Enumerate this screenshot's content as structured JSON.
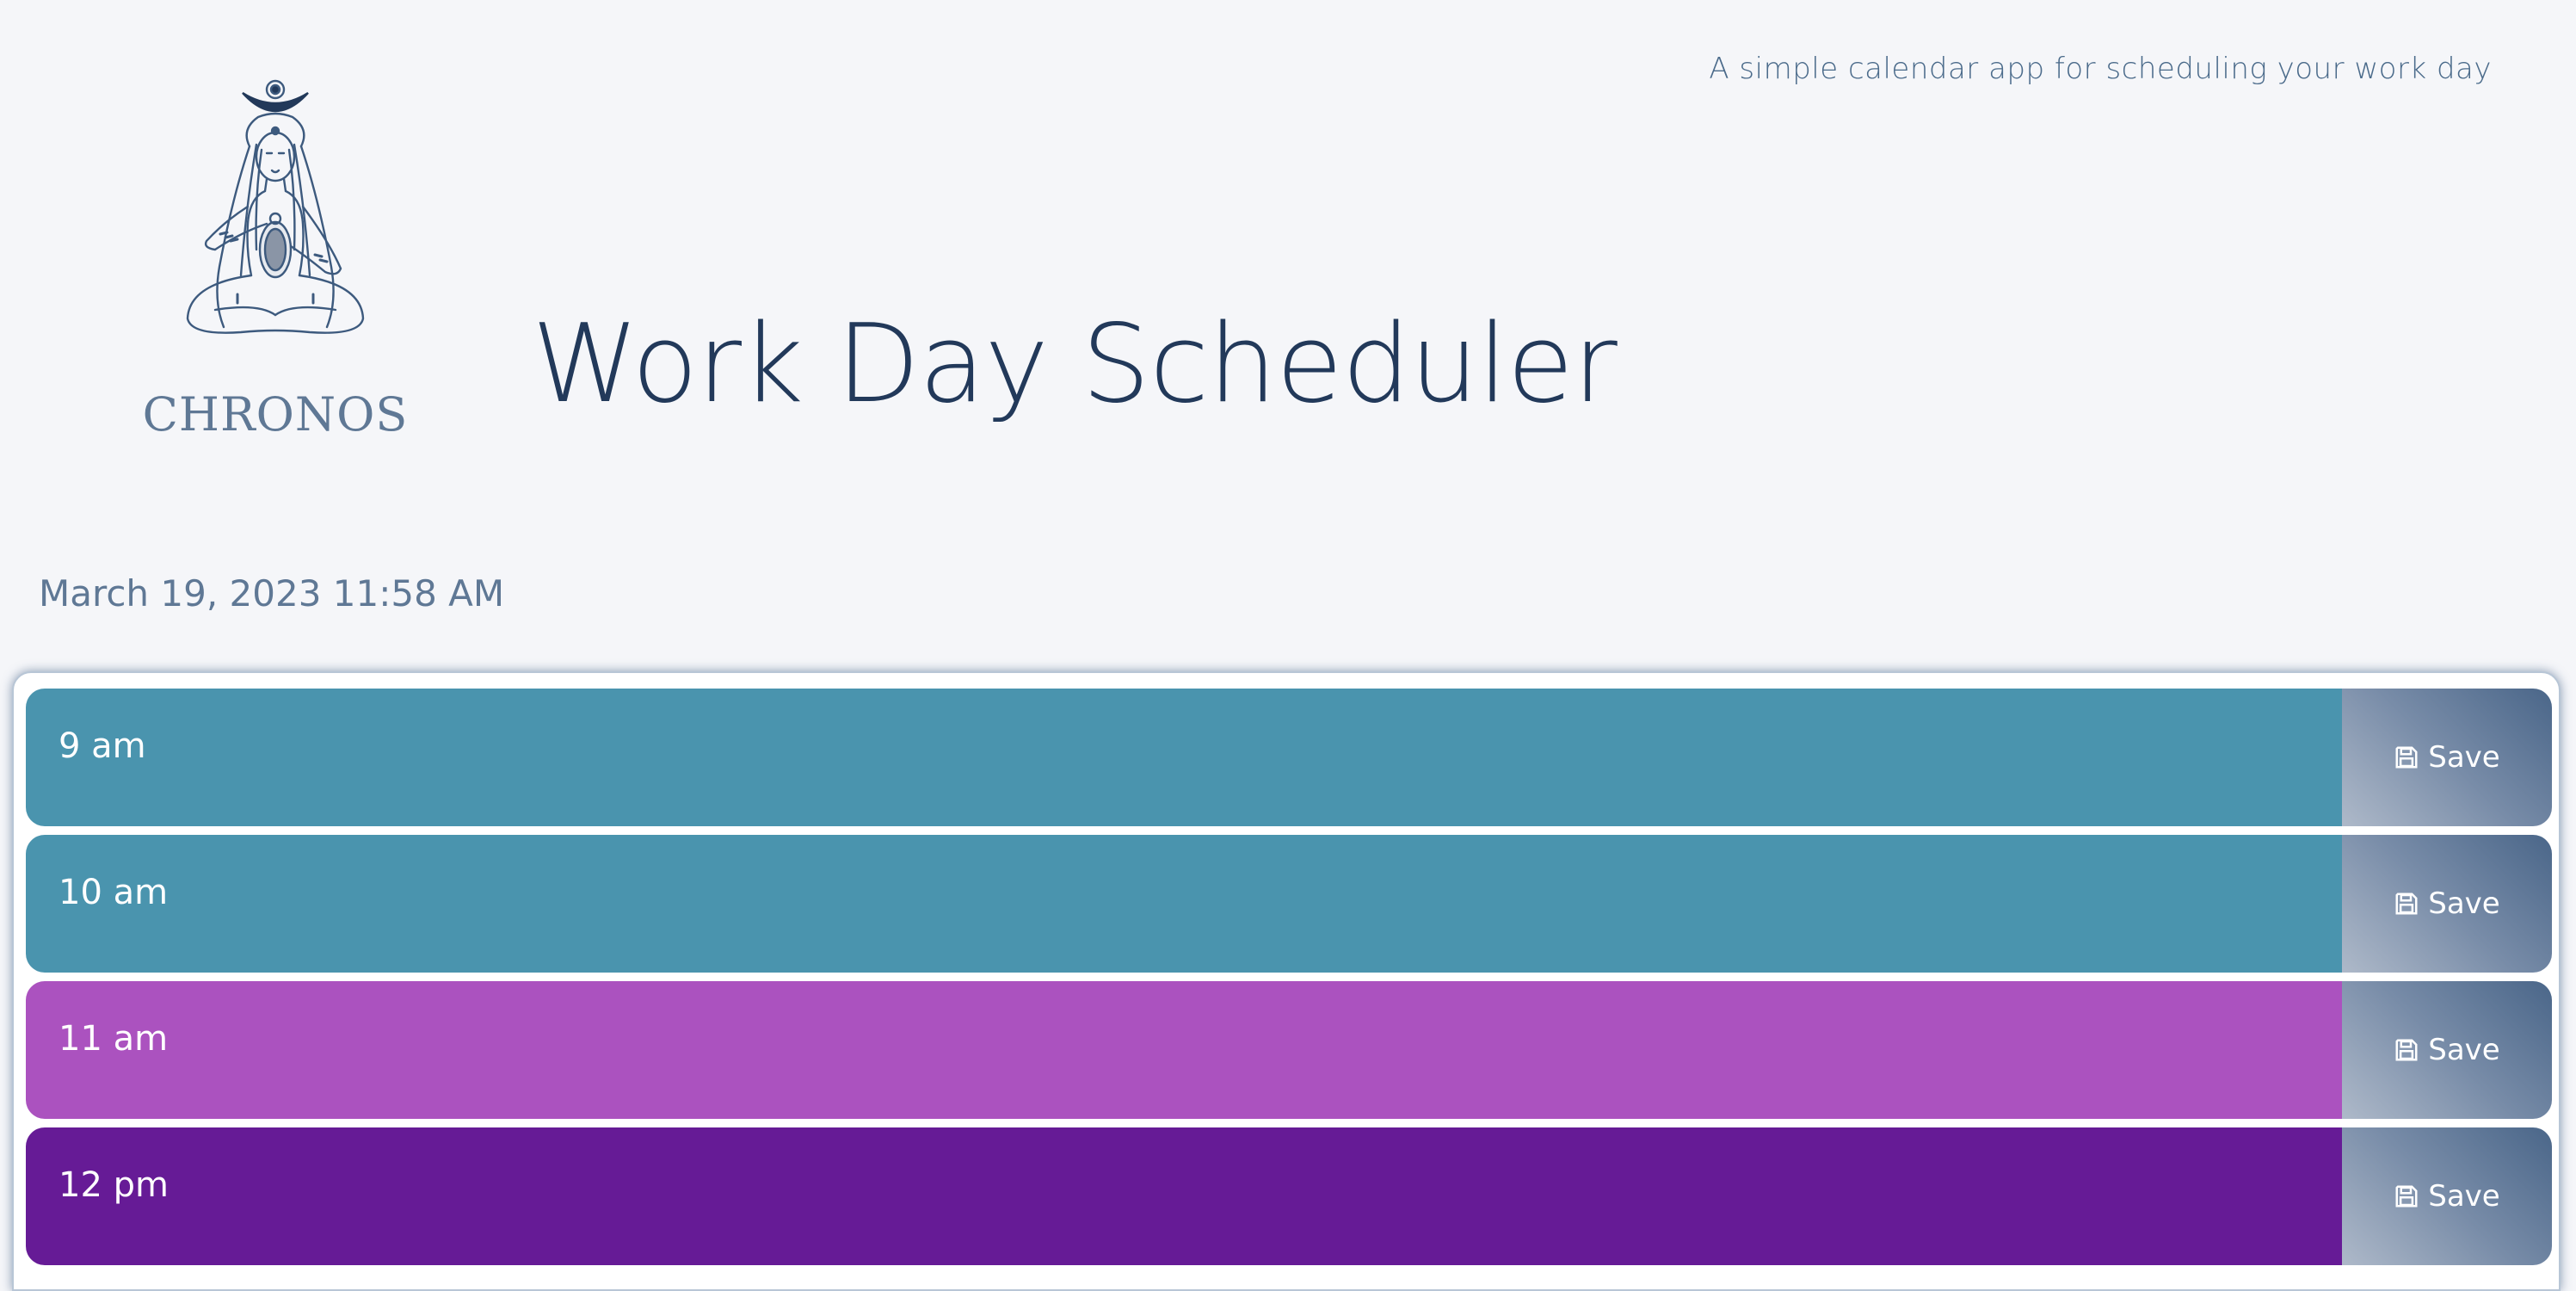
{
  "header": {
    "tagline": "A simple calendar app for scheduling your work day",
    "title": "Work Day Scheduler",
    "logo_text": "CHRONOS"
  },
  "current_datetime": "March 19, 2023 11:58 AM",
  "colors": {
    "past": "#4a94ae",
    "present": "#ab52bf",
    "future": "#661b96",
    "save_dark": "#4a6689",
    "save_light": "#aeb9c9"
  },
  "timeblocks": [
    {
      "hour": "9 am",
      "status": "past",
      "save_label": "Save",
      "icon": "floppy-disk-icon"
    },
    {
      "hour": "10 am",
      "status": "past",
      "save_label": "Save",
      "icon": "floppy-disk-icon"
    },
    {
      "hour": "11 am",
      "status": "present",
      "save_label": "Save",
      "icon": "floppy-disk-icon"
    },
    {
      "hour": "12 pm",
      "status": "future",
      "save_label": "Save",
      "icon": "floppy-disk-icon"
    }
  ]
}
